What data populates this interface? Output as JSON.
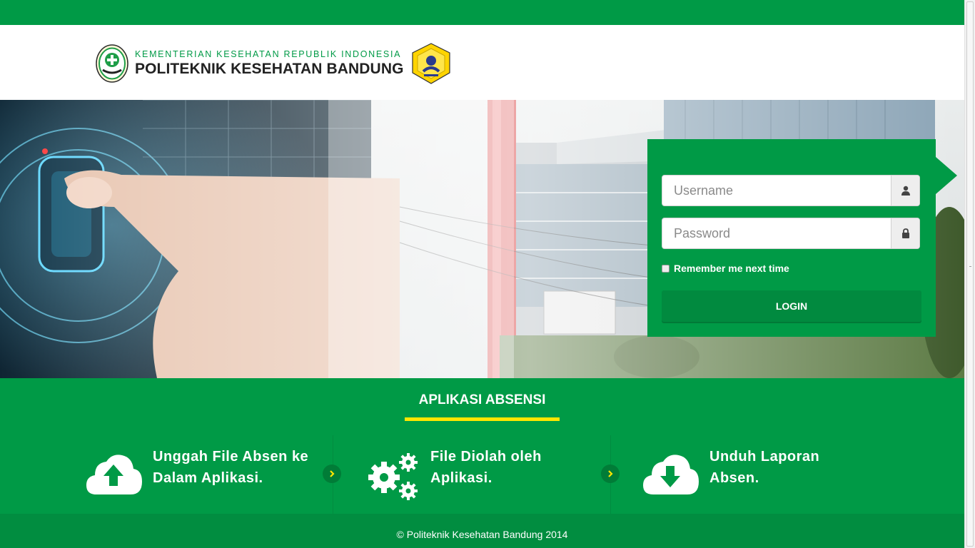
{
  "header": {
    "ministry": "KEMENTERIAN KESEHATAN REPUBLIK INDONESIA",
    "institution": "POLITEKNIK KESEHATAN BANDUNG",
    "colors": {
      "brand_green": "#009a46",
      "accent_yellow": "#ffe600"
    }
  },
  "login": {
    "username_placeholder": "Username",
    "password_placeholder": "Password",
    "username_icon": "user-icon",
    "password_icon": "lock-icon",
    "remember_label": "Remember me next time",
    "button_label": "LOGIN"
  },
  "steps": {
    "title": "APLIKASI ABSENSI",
    "items": [
      {
        "icon": "cloud-upload-icon",
        "line1": "Unggah File Absen ke",
        "line2": "Dalam Aplikasi."
      },
      {
        "icon": "gears-icon",
        "line1": "File Diolah oleh",
        "line2": "Aplikasi."
      },
      {
        "icon": "cloud-download-icon",
        "line1": "Unduh Laporan",
        "line2": "Absen."
      }
    ]
  },
  "footer": {
    "copyright": "© Politeknik Kesehatan Bandung 2014"
  }
}
